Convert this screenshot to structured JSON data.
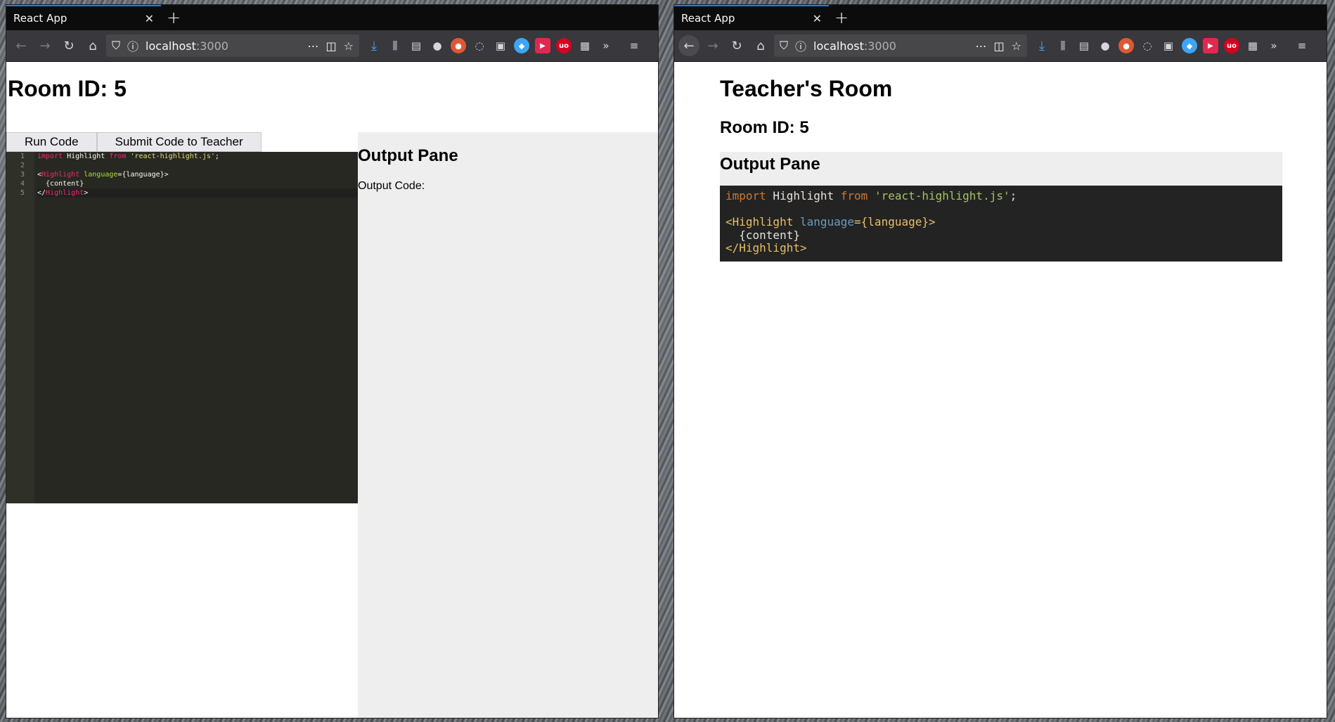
{
  "windows": {
    "left": {
      "tab_title": "React App",
      "url_host": "localhost",
      "url_port": ":3000",
      "page": {
        "room_title": "Room ID: 5",
        "run_button": "Run Code",
        "submit_button": "Submit Code to Teacher",
        "editor": {
          "line_numbers": [
            "1",
            "2",
            "3",
            "4",
            "5"
          ],
          "lines": {
            "l1_import": "import",
            "l1_name": " Highlight ",
            "l1_from": "from",
            "l1_space": " ",
            "l1_str": "'react-highlight.js'",
            "l1_semi": ";",
            "l3_open": "<",
            "l3_tag": "Highlight",
            "l3_sp": " ",
            "l3_attr": "language",
            "l3_rest": "={language}>",
            "l4": "  {content}",
            "l5_open": "</",
            "l5_tag": "Highlight",
            "l5_close": ">"
          }
        },
        "output_title": "Output Pane",
        "output_label": "Output Code:"
      }
    },
    "right": {
      "tab_title": "React App",
      "url_host": "localhost",
      "url_port": ":3000",
      "page": {
        "title": "Teacher's Room",
        "room_id": "Room ID: 5",
        "output_title": "Output Pane",
        "code": {
          "l1_import": "import",
          "l1_name": " Highlight ",
          "l1_from": "from",
          "l1_space": " ",
          "l1_str": "'react-highlight.js'",
          "l1_semi": ";",
          "l3_tag_open": "<Highlight",
          "l3_sp": " ",
          "l3_attr": "language",
          "l3_rest": "={language}>",
          "l4": "  {content}",
          "l5": "</Highlight>"
        }
      }
    }
  },
  "icons": {
    "back": "←",
    "forward": "→",
    "reload": "↻",
    "home": "⌂",
    "shield": "⛉",
    "info": "ⓘ",
    "more": "⋯",
    "pocket": "◫",
    "star": "☆",
    "download": "⤓",
    "library": "⫼",
    "sidebar": "▤",
    "account": "●",
    "overflow": "»",
    "menu": "≡",
    "close": "✕",
    "plus": "+"
  },
  "colors": {
    "tab_accent": "#0a84ff",
    "editor_bg": "#272822",
    "output_bg": "#eeeeee",
    "code_bg": "#232323"
  }
}
